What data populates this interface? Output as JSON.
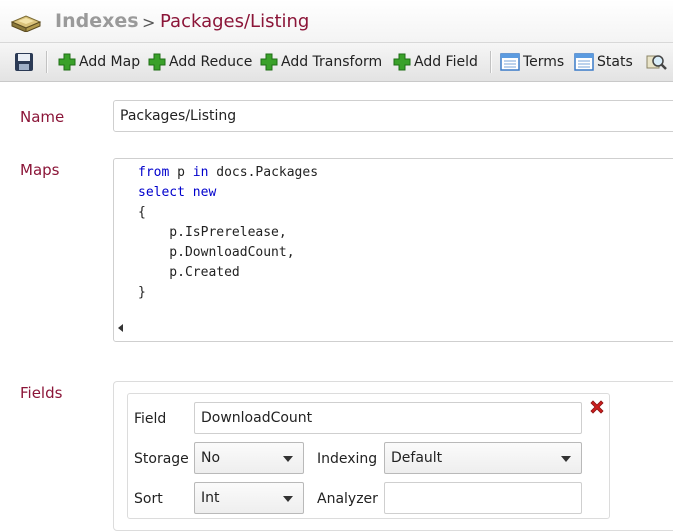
{
  "header": {
    "root": "Indexes",
    "separator": ">",
    "page": "Packages/Listing"
  },
  "toolbar": {
    "add_map": "Add Map",
    "add_reduce": "Add Reduce",
    "add_transform": "Add Transform",
    "add_field": "Add Field",
    "terms": "Terms",
    "stats": "Stats"
  },
  "form": {
    "name_label": "Name",
    "name_value": "Packages/Listing",
    "maps_label": "Maps",
    "fields_label": "Fields"
  },
  "maps_code": [
    "from p in docs.Packages",
    "select new",
    "{",
    "    p.IsPrerelease,",
    "    p.DownloadCount,",
    "    p.Created",
    "}"
  ],
  "field": {
    "field_label": "Field",
    "field_value": "DownloadCount",
    "storage_label": "Storage",
    "storage_value": "No",
    "indexing_label": "Indexing",
    "indexing_value": "Default",
    "sort_label": "Sort",
    "sort_value": "Int",
    "analyzer_label": "Analyzer",
    "analyzer_value": ""
  },
  "colors": {
    "accent": "#8b1538",
    "keyword": "#0000cc",
    "add_green": "#3aa12a",
    "remove_red": "#cc1f1f"
  }
}
